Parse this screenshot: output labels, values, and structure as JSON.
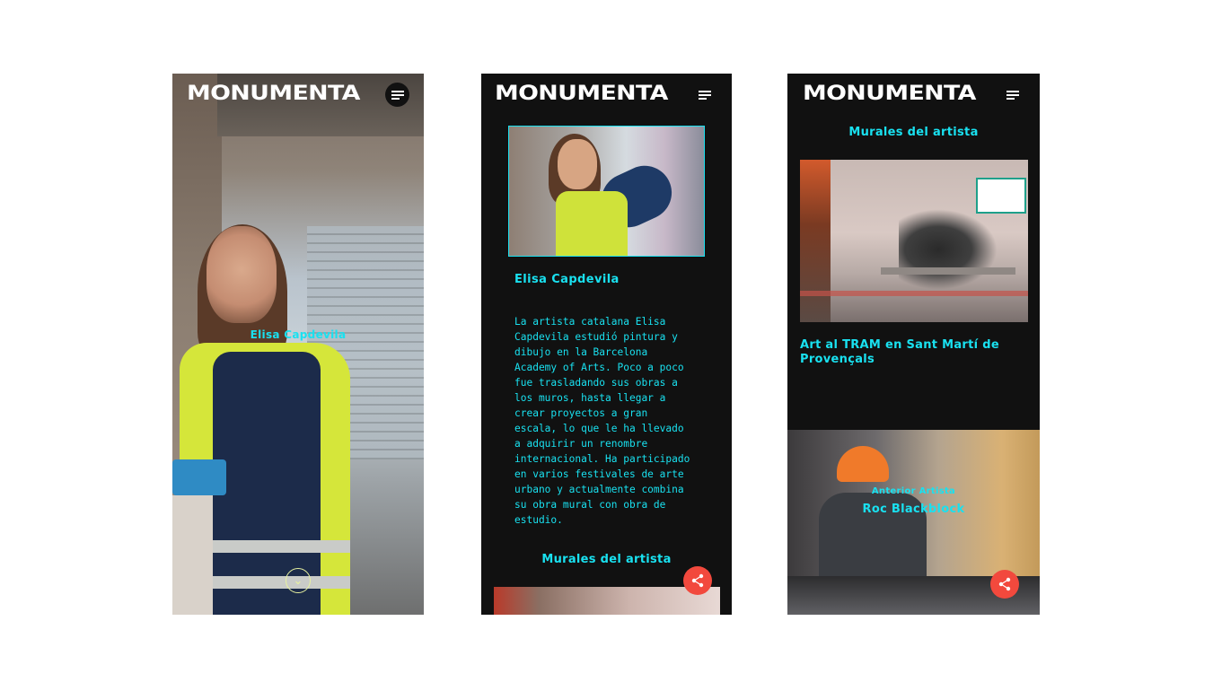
{
  "brand": "MONUMENTA",
  "artist": {
    "name": "Elisa Capdevila",
    "bio": "La artista catalana Elisa Capdevila estudió pintura y dibujo en la Barcelona Academy of Arts. Poco a poco fue trasladando sus obras a los muros, hasta llegar a crear proyectos a gran escala, lo que le ha llevado a adquirir un renombre internacional. Ha participado en varios festivales de arte urbano y actualmente combina su obra mural con obra de estudio."
  },
  "murals_heading": "Murales del artista",
  "mural": {
    "title": "Art al TRAM en Sant Martí de Provençals"
  },
  "previous": {
    "label": "Anterior Artista",
    "name": "Roc Blackblock"
  },
  "icons": {
    "menu": "menu-icon",
    "share": "share-icon",
    "scroll": "chevron-down-icon"
  },
  "colors": {
    "accent": "#19e1f0",
    "background": "#111111",
    "share": "#f2493d"
  }
}
